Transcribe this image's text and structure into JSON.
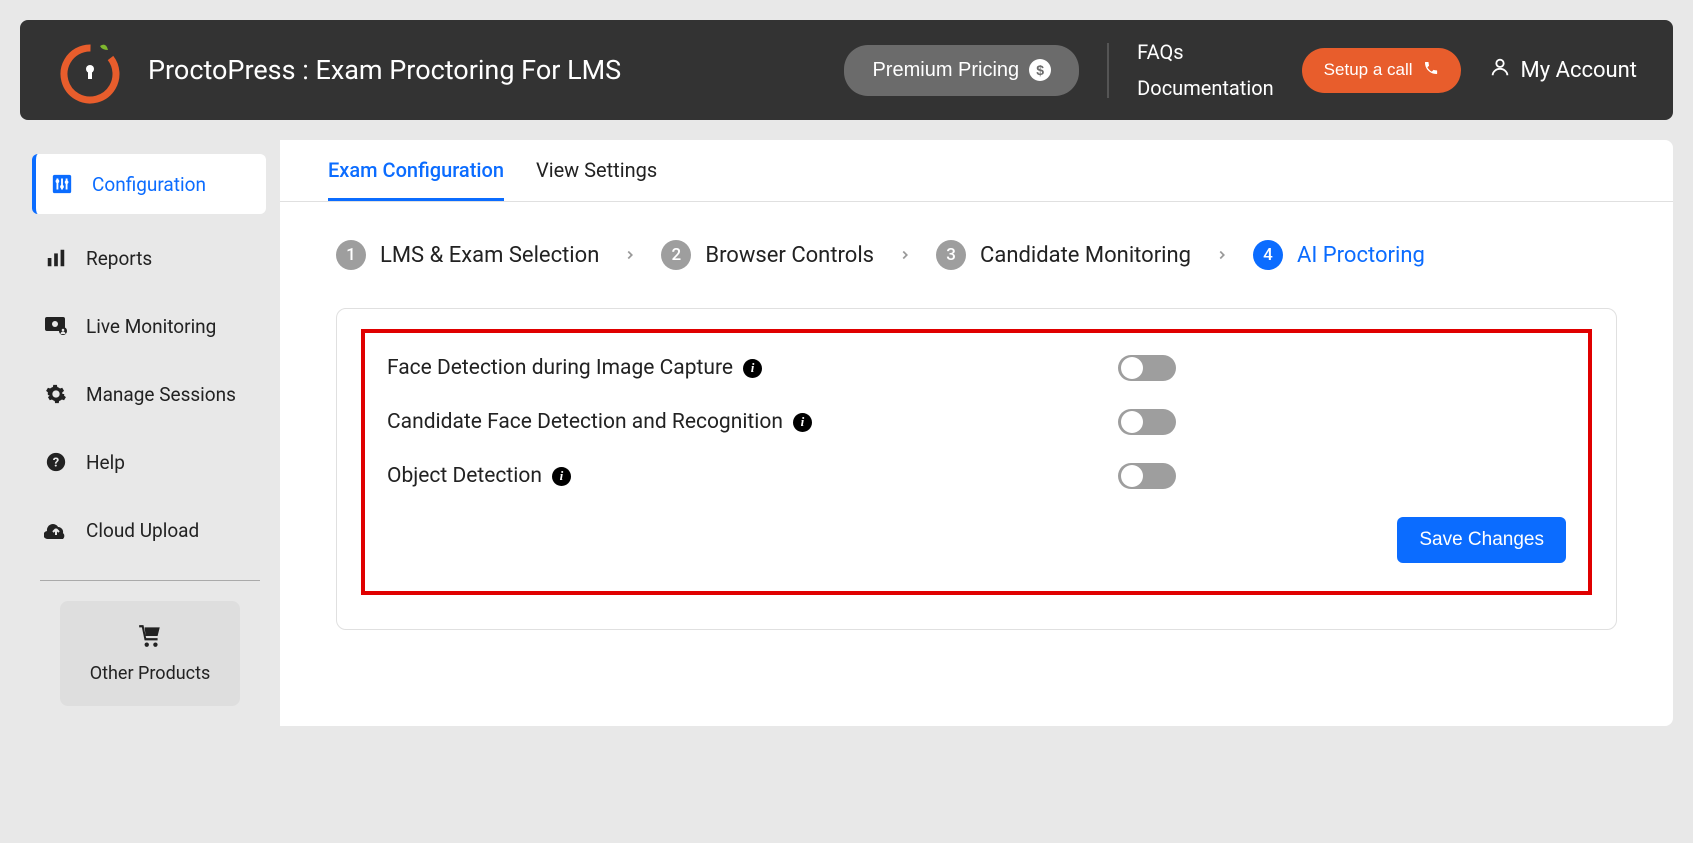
{
  "header": {
    "title": "ProctoPress : Exam Proctoring For LMS",
    "premium_label": "Premium Pricing",
    "faqs": "FAQs",
    "documentation": "Documentation",
    "setup_call": "Setup a call",
    "my_account": "My Account"
  },
  "sidebar": {
    "items": [
      {
        "label": "Configuration"
      },
      {
        "label": "Reports"
      },
      {
        "label": "Live Monitoring"
      },
      {
        "label": "Manage Sessions"
      },
      {
        "label": "Help"
      },
      {
        "label": "Cloud Upload"
      }
    ],
    "other_products": "Other Products"
  },
  "tabs": [
    {
      "label": "Exam Configuration"
    },
    {
      "label": "View Settings"
    }
  ],
  "stepper": [
    {
      "num": "1",
      "label": "LMS & Exam Selection"
    },
    {
      "num": "2",
      "label": "Browser Controls"
    },
    {
      "num": "3",
      "label": "Candidate Monitoring"
    },
    {
      "num": "4",
      "label": "AI Proctoring"
    }
  ],
  "settings": [
    {
      "label": "Face Detection during Image Capture"
    },
    {
      "label": "Candidate Face Detection and Recognition"
    },
    {
      "label": "Object Detection"
    }
  ],
  "save_label": "Save Changes",
  "colors": {
    "accent_blue": "#0b6cff",
    "accent_orange": "#e85d2c",
    "header_bg": "#333333",
    "highlight_red": "#e00000"
  }
}
